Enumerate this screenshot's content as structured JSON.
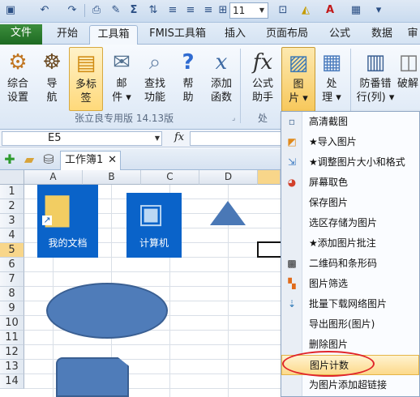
{
  "quick_access": {
    "font_size_value": "11",
    "icons": [
      "save-icon",
      "undo-icon",
      "redo-icon",
      "print-preview-icon",
      "format-painter-icon",
      "sum-icon",
      "sort-icon",
      "align-left-icon",
      "align-center-icon",
      "align-right-icon",
      "border-icon",
      "fill-color-icon",
      "font-color-icon",
      "merge-icon"
    ]
  },
  "tabs": [
    {
      "label": "文件"
    },
    {
      "label": "开始"
    },
    {
      "label": "工具箱"
    },
    {
      "label": "FMIS工具箱"
    },
    {
      "label": "插入"
    },
    {
      "label": "页面布局"
    },
    {
      "label": "公式"
    },
    {
      "label": "数据"
    },
    {
      "label": "审"
    }
  ],
  "active_tab_index": 2,
  "ribbon": {
    "buttons": [
      {
        "line1": "综合",
        "line2": "设置",
        "icon": "settings-icon"
      },
      {
        "line1": "导",
        "line2": "航",
        "icon": "ship-wheel-icon"
      },
      {
        "line1": "多标",
        "line2": "签",
        "icon": "multi-tab-icon"
      },
      {
        "line1": "邮",
        "line2": "件 ▾",
        "icon": "mail-icon"
      },
      {
        "line1": "查找",
        "line2": "功能",
        "icon": "find-icon"
      },
      {
        "line1": "帮",
        "line2": "助",
        "icon": "help-icon"
      },
      {
        "line1": "添加",
        "line2": "函数",
        "icon": "add-function-icon"
      },
      {
        "line1": "公式",
        "line2": "助手",
        "icon": "formula-icon"
      },
      {
        "line1": "图",
        "line2": "片 ▾",
        "icon": "picture-icon"
      },
      {
        "line1": "处",
        "line2": "理 ▾",
        "icon": "process-icon"
      },
      {
        "line1": "防番错",
        "line2": "行(列) ▾",
        "icon": "row-guard-icon"
      },
      {
        "line1": "",
        "line2": "破解",
        "icon": "crack-icon"
      }
    ],
    "group_label": "张立良专用版 14.13版",
    "group_label_partial": "处"
  },
  "formula_bar": {
    "name_box": "E5",
    "fx_label": "fx",
    "formula": ""
  },
  "workbook": {
    "tab_label": "工作簿1",
    "close_label": "✕"
  },
  "grid": {
    "columns": [
      "A",
      "B",
      "C",
      "D"
    ],
    "rows": [
      "1",
      "2",
      "3",
      "4",
      "5",
      "6",
      "7",
      "8",
      "9",
      "10",
      "11",
      "12",
      "13",
      "14"
    ],
    "selected_row": "5",
    "tiles": [
      {
        "label": "我的文档",
        "icon": "folder-icon"
      },
      {
        "label": "计算机",
        "icon": "computer-icon"
      }
    ]
  },
  "menu": {
    "items": [
      {
        "label": "高清截图",
        "icon": "screenshot-icon"
      },
      {
        "label": "★导入图片",
        "icon": "import-picture-icon"
      },
      {
        "label": "★调整图片大小和格式",
        "icon": "resize-picture-icon"
      },
      {
        "label": "屏幕取色",
        "icon": "color-picker-icon"
      },
      {
        "label": "保存图片",
        "icon": ""
      },
      {
        "label": "选区存储为图片",
        "icon": ""
      },
      {
        "label": "★添加图片批注",
        "icon": ""
      },
      {
        "label": "二维码和条形码",
        "icon": "qr-code-icon"
      },
      {
        "label": "图片筛选",
        "icon": "filter-picture-icon"
      },
      {
        "label": "批量下载网络图片",
        "icon": "download-picture-icon"
      },
      {
        "label": "导出图形(图片)",
        "icon": ""
      },
      {
        "label": "删除图片",
        "icon": ""
      },
      {
        "label": "图片计数",
        "icon": ""
      },
      {
        "label": "为图片添加超链接",
        "icon": ""
      }
    ],
    "highlighted_index": 12
  },
  "colors": {
    "tile_blue": "#0a63c9",
    "shape_blue": "#4f7cb9",
    "annotation_red": "#e0252b",
    "file_tab_green": "#2a7d2e"
  }
}
